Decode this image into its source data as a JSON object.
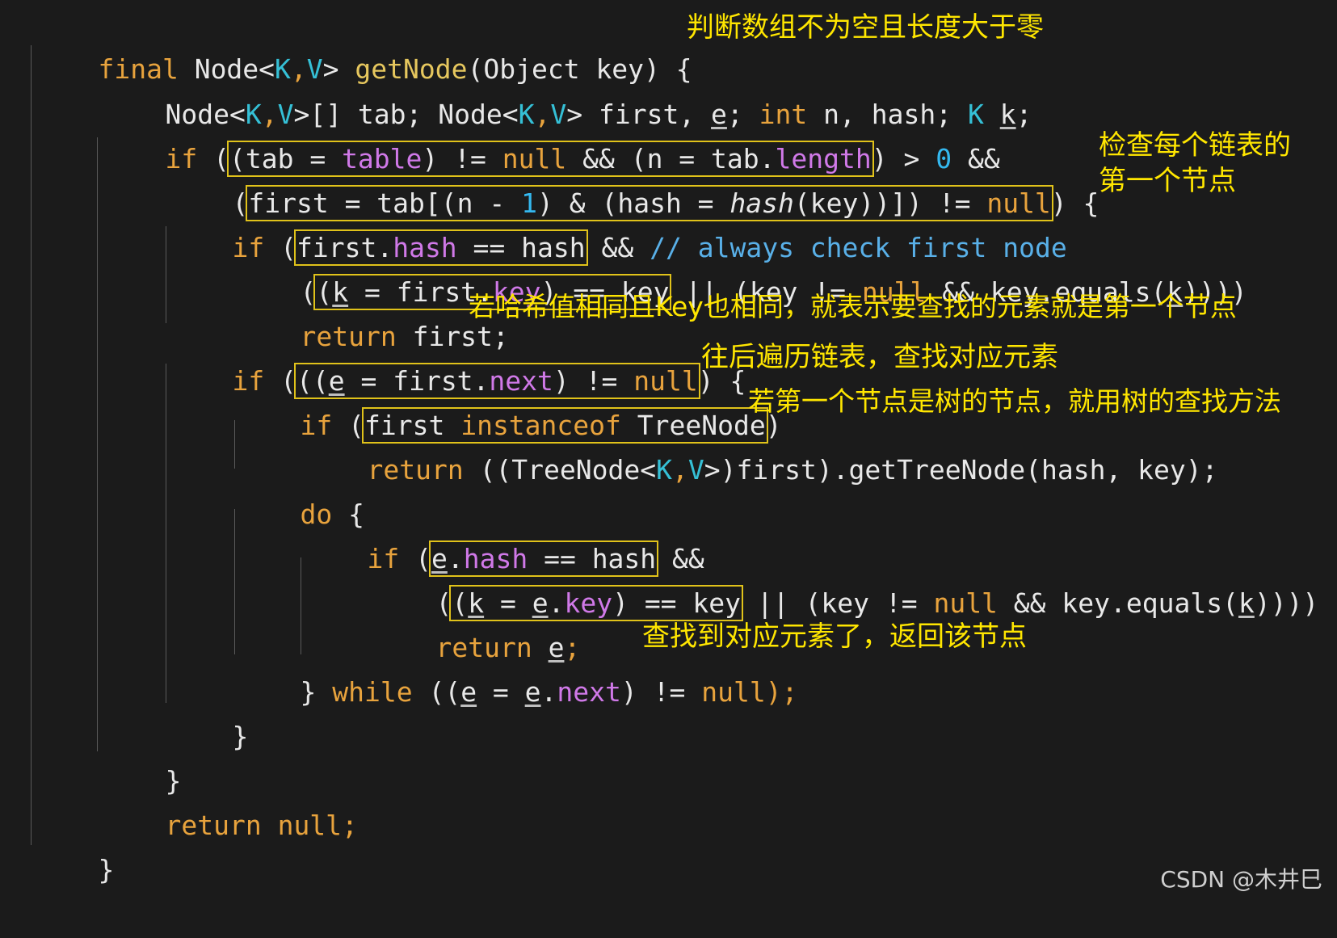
{
  "lines": [
    {
      "t": [
        "final",
        " Node<",
        "K",
        ",",
        "V",
        "> ",
        "getNode",
        "(Object key) {"
      ]
    },
    {
      "t": [
        "Node<",
        "K",
        ",",
        "V",
        ">[] tab; Node<",
        "K",
        ",",
        "V",
        "> first, ",
        "e",
        "; ",
        "int",
        " n, hash; ",
        "K",
        " ",
        "k",
        ";"
      ]
    },
    {
      "t": [
        "if",
        " (",
        "(tab = ",
        "table",
        ") != ",
        "null",
        " && (n = tab.",
        "length",
        ")",
        " > ",
        "0",
        " &&"
      ]
    },
    {
      "t": [
        "(",
        "first = tab[(n - ",
        "1",
        ") & (hash = ",
        "hash",
        "(key))]) != ",
        "null",
        ") {"
      ]
    },
    {
      "t": [
        "if",
        " (",
        "first.",
        "hash",
        " == hash",
        " && ",
        "// always check first node"
      ]
    },
    {
      "t": [
        "(",
        "(",
        "k",
        " = first.",
        "key",
        ") == key",
        " || (key != ",
        "null",
        " && key.equals(",
        "k",
        "))))"
      ]
    },
    {
      "t": [
        "return",
        " first;"
      ]
    },
    {
      "t": [
        "if",
        " (",
        "((",
        "e",
        " = first.",
        "next",
        ") != ",
        "null",
        ") {"
      ]
    },
    {
      "t": [
        "if",
        " (",
        "first ",
        "instanceof",
        " TreeNode",
        ")"
      ]
    },
    {
      "t": [
        "return",
        " ((TreeNode<",
        "K",
        ",",
        "V",
        ">)first).getTreeNode(hash, key);"
      ]
    },
    {
      "t": [
        "do",
        " {"
      ]
    },
    {
      "t": [
        "if",
        " (",
        "e",
        ".",
        "hash",
        " == hash",
        " &&"
      ]
    },
    {
      "t": [
        "(",
        "(",
        "k",
        " = ",
        "e",
        ".",
        "key",
        ") == key",
        " || (key != ",
        "null",
        " && key.equals(",
        "k",
        "))))"
      ]
    },
    {
      "t": [
        "return",
        " ",
        "e",
        ";"
      ]
    },
    {
      "t": [
        "} ",
        "while",
        " ((",
        "e",
        " = ",
        "e",
        ".",
        "next",
        ") != ",
        "null",
        ");"
      ]
    },
    {
      "t": [
        "}"
      ]
    },
    {
      "t": [
        "}"
      ]
    },
    {
      "t": [
        "return",
        " null;"
      ]
    },
    {
      "t": [
        "}"
      ]
    }
  ],
  "notes": {
    "n1": "判断数组不为空且长度大于零",
    "n2a": "检查每个链表的",
    "n2b": "第一个节点",
    "n3": "若哈希值相同且Key也相同，就表示要查找的元素就是第一个节点",
    "n4": "往后遍历链表，查找对应元素",
    "n5": "若第一个节点是树的节点，就用树的查找方法",
    "n6": "查找到对应元素了，返回该节点"
  },
  "watermark": "CSDN @木井巳",
  "colors": {
    "background": "#1b1b1b",
    "keyword": "#e8a33d",
    "type_param": "#35c0d6",
    "method": "#e6c75e",
    "field": "#d079e8",
    "number": "#34b8ef",
    "comment": "#59b0e8",
    "annotation": "#ffe600",
    "highlight_box": "#e0c21a"
  }
}
